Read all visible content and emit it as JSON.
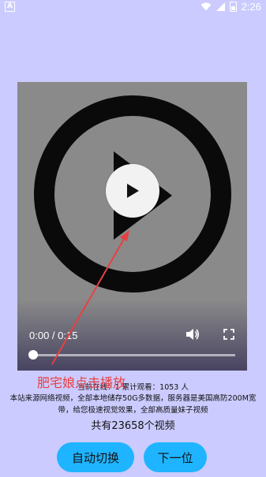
{
  "status_bar": {
    "notification_letter": "A",
    "time": "2:26"
  },
  "player": {
    "time_display": "0:00 / 0:15",
    "progress_fraction": 0.0
  },
  "annotation": {
    "label": "肥宅娘点击播放"
  },
  "info": {
    "stats": "当前在线：1  累计观看：1053 人",
    "description_line1": "本站来源网络视频，全部本地储存50G多数据，服务器是美国高防200M宽",
    "description_line2": "带，给您极速视觉效果，全部高质量妹子视频",
    "total": "共有23658个视频"
  },
  "buttons": {
    "auto_switch": "自动切换",
    "next": "下一位"
  },
  "colors": {
    "background": "#cbcbff",
    "button": "#1fb4ff",
    "annotation": "#e84040"
  }
}
